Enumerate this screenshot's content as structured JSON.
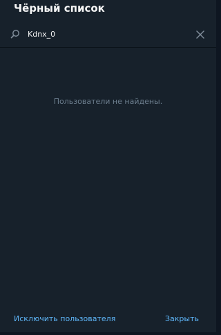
{
  "dialog": {
    "title": "Чёрный список"
  },
  "search": {
    "value": "Kdnx_0",
    "search_icon": "search-icon",
    "clear_icon": "close-icon"
  },
  "results": {
    "empty_message": "Пользователи не найдены."
  },
  "footer": {
    "exclude_label": "Исключить пользователя",
    "close_label": "Закрыть"
  },
  "colors": {
    "background": "#17212b",
    "text": "#f5f5f5",
    "muted": "#6d7f8f",
    "accent": "#5eb5f7"
  }
}
